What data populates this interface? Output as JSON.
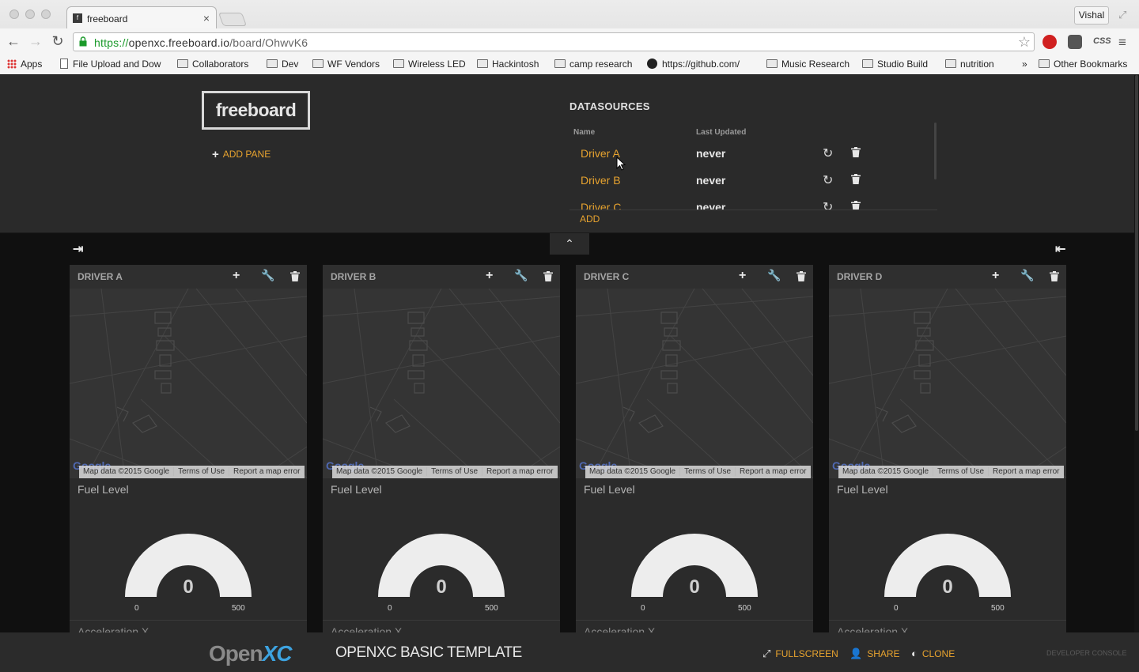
{
  "browser": {
    "tab_title": "freeboard",
    "tab_favicon": "f",
    "profile_name": "Vishal",
    "url_scheme": "https://",
    "url_host": "openxc.freeboard.io",
    "url_path": "/board/OhwvK6",
    "ext_css_label": "CSS",
    "bookmarks": [
      {
        "label": "Apps",
        "icon": "apps-icon"
      },
      {
        "label": "File Upload and Dow",
        "icon": "page-icon"
      },
      {
        "label": "Collaborators",
        "icon": "folder-icon"
      },
      {
        "label": "Dev",
        "icon": "folder-icon"
      },
      {
        "label": "WF Vendors",
        "icon": "folder-icon"
      },
      {
        "label": "Wireless LED",
        "icon": "folder-icon"
      },
      {
        "label": "Hackintosh",
        "icon": "folder-icon"
      },
      {
        "label": "camp research",
        "icon": "folder-icon"
      },
      {
        "label": "https://github.com/",
        "icon": "github-icon"
      },
      {
        "label": "Music Research",
        "icon": "folder-icon"
      },
      {
        "label": "Studio Build",
        "icon": "folder-icon"
      },
      {
        "label": "nutrition",
        "icon": "folder-icon"
      },
      {
        "label": "»",
        "icon": ""
      },
      {
        "label": "Other Bookmarks",
        "icon": "folder-icon"
      }
    ]
  },
  "header": {
    "logo": "freeboard",
    "add_pane": "ADD PANE",
    "datasources": {
      "title": "DATASOURCES",
      "col_name": "Name",
      "col_updated": "Last Updated",
      "rows": [
        {
          "name": "Driver A",
          "updated": "never"
        },
        {
          "name": "Driver B",
          "updated": "never"
        },
        {
          "name": "Driver C",
          "updated": "never"
        }
      ],
      "add": "ADD"
    }
  },
  "panes": [
    {
      "title": "DRIVER A",
      "widget_title": "Fuel Level",
      "gauge_value": "0",
      "gauge_min": "0",
      "gauge_max": "500",
      "next_widget": "Acceleration X"
    },
    {
      "title": "DRIVER B",
      "widget_title": "Fuel Level",
      "gauge_value": "0",
      "gauge_min": "0",
      "gauge_max": "500",
      "next_widget": "Acceleration X"
    },
    {
      "title": "DRIVER C",
      "widget_title": "Fuel Level",
      "gauge_value": "0",
      "gauge_min": "0",
      "gauge_max": "500",
      "next_widget": "Acceleration X"
    },
    {
      "title": "DRIVER D",
      "widget_title": "Fuel Level",
      "gauge_value": "0",
      "gauge_min": "0",
      "gauge_max": "500",
      "next_widget": "Acceleration X"
    }
  ],
  "map_attribution": {
    "logo": "Google",
    "data": "Map data ©2015 Google",
    "terms": "Terms of Use",
    "report": "Report a map error"
  },
  "footer": {
    "logo_open": "Open",
    "logo_xc": "XC",
    "template_title": "OPENXC BASIC TEMPLATE",
    "fullscreen": "FULLSCREEN",
    "share": "SHARE",
    "clone": "CLONE",
    "developer_console": "DEVELOPER CONSOLE"
  },
  "colors": {
    "accent": "#e7a32f",
    "header_bg": "#2a2a2a",
    "board_bg": "#101010",
    "pane_bg": "#2b2b2b",
    "gauge_fill": "#ededed"
  }
}
